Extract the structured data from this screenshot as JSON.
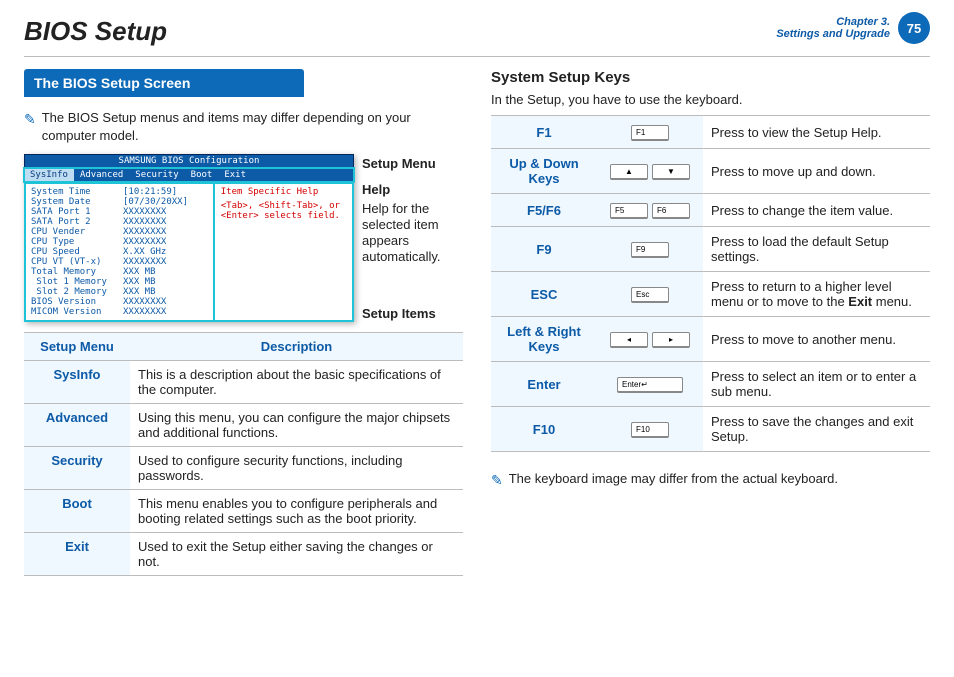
{
  "header": {
    "title": "BIOS Setup",
    "chapter_line1": "Chapter 3.",
    "chapter_line2": "Settings and Upgrade",
    "page_number": "75"
  },
  "left": {
    "section_title": "The BIOS Setup Screen",
    "note": "The BIOS Setup menus and items may differ depending on your computer model.",
    "bios_screenshot": {
      "window_title": "SAMSUNG BIOS Configuration",
      "tabs": [
        "SysInfo",
        "Advanced",
        "Security",
        "Boot",
        "Exit"
      ],
      "active_tab": "SysInfo",
      "sysinfo_rows": [
        {
          "k": "System Time",
          "v": "[10:21:59]"
        },
        {
          "k": "System Date",
          "v": "[07/30/20XX]"
        },
        {
          "k": "",
          "v": ""
        },
        {
          "k": "SATA Port 1",
          "v": "XXXXXXXX"
        },
        {
          "k": "SATA Port 2",
          "v": "XXXXXXXX"
        },
        {
          "k": "",
          "v": ""
        },
        {
          "k": "CPU Vender",
          "v": "XXXXXXXX"
        },
        {
          "k": "CPU Type",
          "v": "XXXXXXXX"
        },
        {
          "k": "CPU Speed",
          "v": "X.XX GHz"
        },
        {
          "k": "CPU VT (VT-x)",
          "v": "XXXXXXXX"
        },
        {
          "k": "",
          "v": ""
        },
        {
          "k": "Total Memory",
          "v": "XXX MB"
        },
        {
          "k": " Slot 1 Memory",
          "v": "XXX MB"
        },
        {
          "k": " Slot 2 Memory",
          "v": "XXX MB"
        },
        {
          "k": "",
          "v": ""
        },
        {
          "k": "BIOS Version",
          "v": "XXXXXXXX"
        },
        {
          "k": "MICOM Version",
          "v": "XXXXXXXX"
        }
      ],
      "help_title": "Item Specific Help",
      "help_body": "<Tab>, <Shift-Tab>, or <Enter> selects field."
    },
    "callouts": {
      "setup_menu": "Setup Menu",
      "help": "Help",
      "help_desc": "Help for the selected item appears automatically.",
      "setup_items": "Setup Items"
    },
    "desc_table": {
      "headers": [
        "Setup Menu",
        "Description"
      ],
      "rows": [
        {
          "name": "SysInfo",
          "desc": "This is a description about the basic specifications of the computer."
        },
        {
          "name": "Advanced",
          "desc": "Using this menu, you can configure the major chipsets and additional functions."
        },
        {
          "name": "Security",
          "desc": "Used to configure security functions, including passwords."
        },
        {
          "name": "Boot",
          "desc": "This menu enables you to configure peripherals and booting related settings such as the boot priority."
        },
        {
          "name": "Exit",
          "desc": "Used to exit the Setup either saving the changes or not."
        }
      ]
    }
  },
  "right": {
    "heading": "System Setup Keys",
    "intro": "In the Setup, you have to use the keyboard.",
    "keys": [
      {
        "name": "F1",
        "caps": [
          "F1"
        ],
        "desc": "Press to view the Setup Help."
      },
      {
        "name": "Up & Down Keys",
        "caps": [
          "▲",
          "▼"
        ],
        "center": true,
        "desc": "Press to move up and down."
      },
      {
        "name": "F5/F6",
        "caps": [
          "F5",
          "F6"
        ],
        "desc": "Press to change the item value."
      },
      {
        "name": "F9",
        "caps": [
          "F9"
        ],
        "desc": "Press to load the default Setup settings."
      },
      {
        "name": "ESC",
        "caps": [
          "Esc"
        ],
        "boldword": "Exit",
        "desc_pre": "Press to return to a higher level menu or to move to the ",
        "desc_post": " menu."
      },
      {
        "name": "Left & Right Keys",
        "caps": [
          "◂",
          "▸"
        ],
        "center": true,
        "desc": "Press to move to another menu."
      },
      {
        "name": "Enter",
        "caps": [
          "Enter↵"
        ],
        "wide": true,
        "desc": "Press to select an item or to enter a sub menu."
      },
      {
        "name": "F10",
        "caps": [
          "F10"
        ],
        "desc": "Press to save the changes and exit Setup."
      }
    ],
    "bottom_note": "The keyboard image may differ from the actual keyboard."
  }
}
